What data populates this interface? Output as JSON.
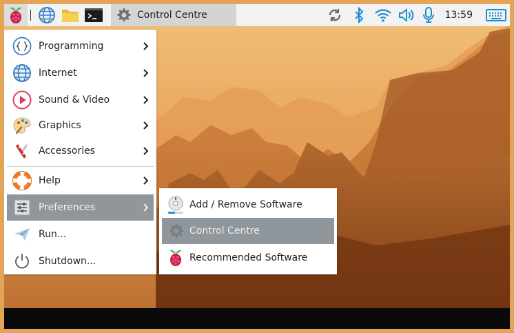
{
  "panel": {
    "active_window": "Control Centre",
    "clock": "13:59",
    "launchers": [
      "web-browser",
      "file-manager",
      "terminal"
    ]
  },
  "main_menu": {
    "items": [
      {
        "label": "Programming",
        "icon": "programming-icon",
        "submenu": true
      },
      {
        "label": "Internet",
        "icon": "globe-icon",
        "submenu": true
      },
      {
        "label": "Sound & Video",
        "icon": "play-icon",
        "submenu": true
      },
      {
        "label": "Graphics",
        "icon": "palette-icon",
        "submenu": true
      },
      {
        "label": "Accessories",
        "icon": "pocket-knife-icon",
        "submenu": true
      },
      {
        "label": "Help",
        "icon": "lifebuoy-icon",
        "submenu": true
      },
      {
        "label": "Preferences",
        "icon": "sliders-icon",
        "submenu": true,
        "selected": true
      },
      {
        "label": "Run...",
        "icon": "paper-plane-icon",
        "submenu": false
      },
      {
        "label": "Shutdown...",
        "icon": "power-icon",
        "submenu": false
      }
    ]
  },
  "preferences_submenu": {
    "items": [
      {
        "label": "Add / Remove Software",
        "icon": "package-disc-icon"
      },
      {
        "label": "Control Centre",
        "icon": "gear-icon",
        "selected": true
      },
      {
        "label": "Recommended Software",
        "icon": "raspberry-icon"
      }
    ]
  },
  "colors": {
    "panel_bg": "#f2f2f2",
    "selection": "#8f969c",
    "tray_blue": "#1a8fd6",
    "frame": "#e3a458"
  }
}
